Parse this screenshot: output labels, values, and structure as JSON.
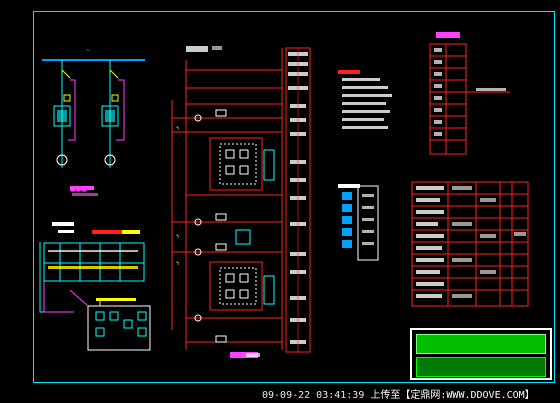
{
  "caption": {
    "date_time": "09-09-22 03:41:39",
    "upload_text": "上传至【定鼎网:WWW.DDOVE.COM】"
  },
  "colors": {
    "background": "#000000",
    "frame": "#00e0ff",
    "wire_red": "#ff2020",
    "wire_magenta": "#ff40ff",
    "symbol_cyan": "#00ffff",
    "text_yellow": "#ffff00",
    "stamp_green": "#00c000"
  },
  "icons": {
    "breaker": "breaker-icon",
    "relay": "relay-icon",
    "terminal": "terminal-block-icon"
  }
}
